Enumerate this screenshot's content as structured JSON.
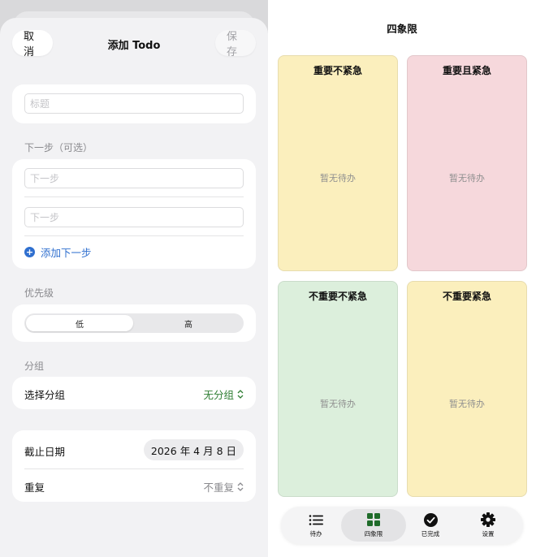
{
  "add_todo": {
    "title": "添加 Todo",
    "cancel_label": "取消",
    "save_label": "保存",
    "title_placeholder": "标题",
    "next_step_section": "下一步（可选）",
    "next_step_placeholders": [
      "下一步",
      "下一步"
    ],
    "add_next_step_label": "添加下一步",
    "priority_section": "优先级",
    "priority_options": [
      "低",
      "高"
    ],
    "priority_selected": "低",
    "group_section": "分组",
    "group_row_label": "选择分组",
    "group_value": "无分组",
    "deadline_label": "截止日期",
    "deadline_value": "2026 年 4 月 8 日",
    "repeat_label": "重复",
    "repeat_value": "不重复"
  },
  "quadrant_screen": {
    "title": "四象限",
    "quadrants": [
      {
        "title": "重要不紧急",
        "empty_text": "暂无待办",
        "color": "#fbefbd"
      },
      {
        "title": "重要且紧急",
        "empty_text": "暂无待办",
        "color": "#f6d8dc"
      },
      {
        "title": "不重要不紧急",
        "empty_text": "暂无待办",
        "color": "#dcefdc"
      },
      {
        "title": "不重要紧急",
        "empty_text": "暂无待办",
        "color": "#fbefbd"
      }
    ]
  },
  "tabbar": {
    "tabs": [
      {
        "label": "待办",
        "icon": "list-icon"
      },
      {
        "label": "四象限",
        "icon": "grid-icon"
      },
      {
        "label": "已完成",
        "icon": "check-circle-icon"
      },
      {
        "label": "设置",
        "icon": "gear-icon"
      }
    ],
    "active": "四象限",
    "accent": "#1f6b2a"
  },
  "colors": {
    "link_blue": "#2f6fcf",
    "group_green": "#2e7d32"
  }
}
